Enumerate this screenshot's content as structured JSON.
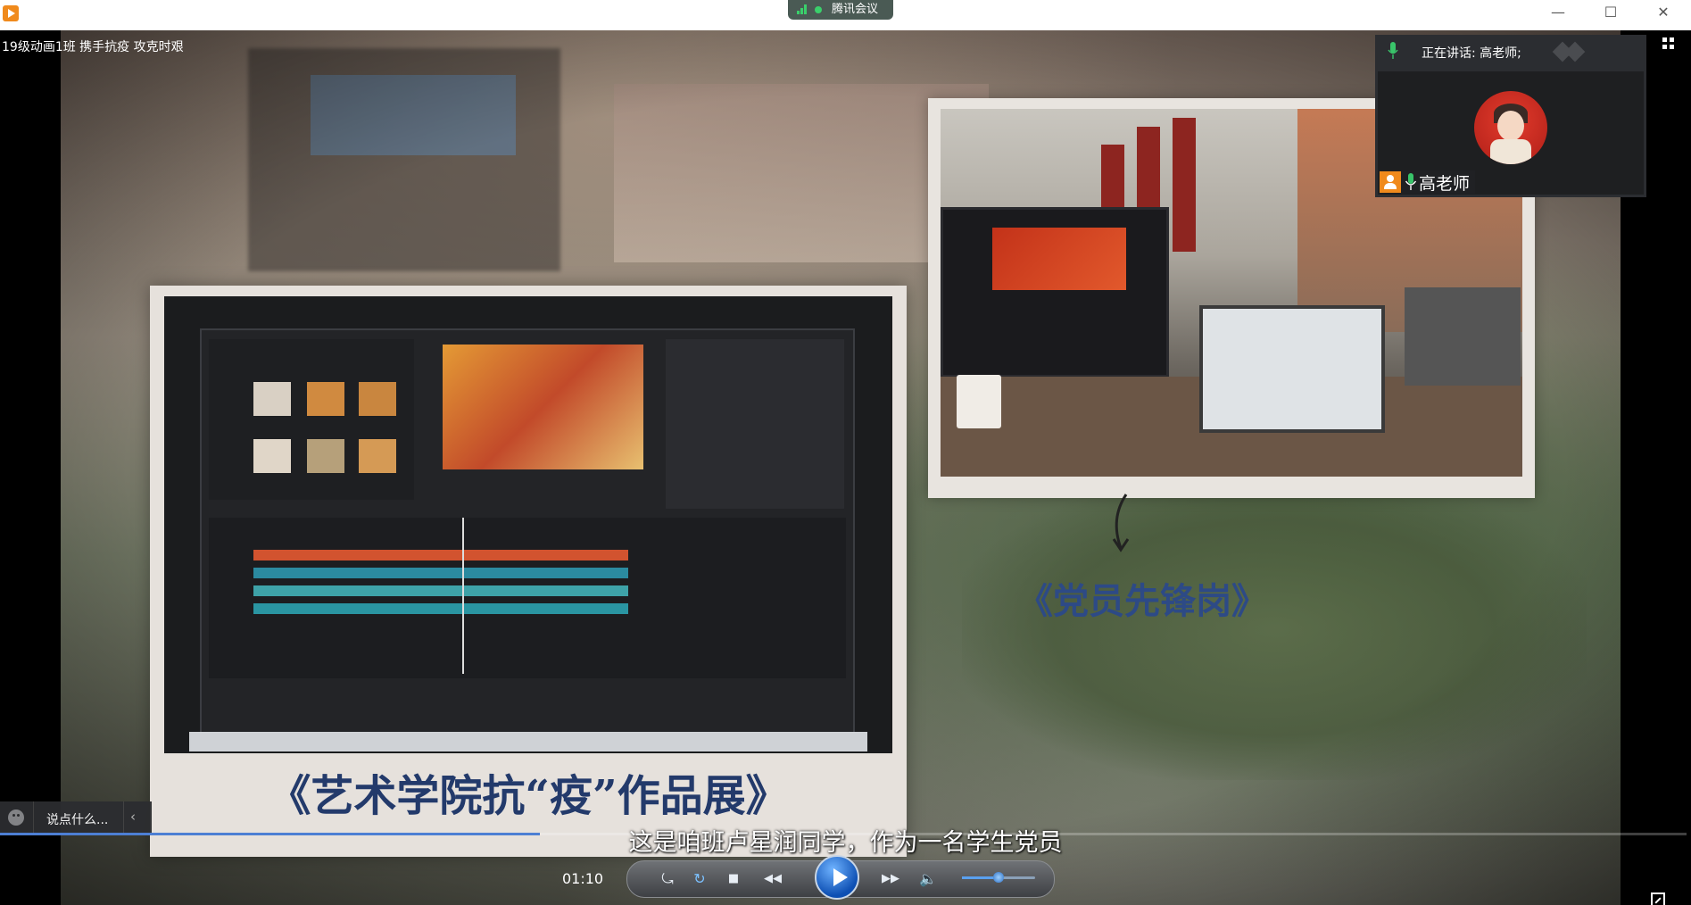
{
  "window": {
    "meeting_badge": "腾讯会议",
    "minimize": "—",
    "maximize": "☐",
    "close": "✕"
  },
  "video": {
    "title": "19级动画1班 携手抗疫   攻克时艰",
    "caption_left": "《艺术学院抗“疫”作品展》",
    "caption_right": "《党员先锋岗》",
    "subtitle": "这是咱班卢星润同学，作为一名学生党员"
  },
  "speaker": {
    "label": "正在讲话: 高老师;",
    "name": "高老师"
  },
  "chat": {
    "placeholder": "说点什么...",
    "toggle": "‹"
  },
  "player": {
    "time": "01:10",
    "progress": 0.32,
    "volume": 0.5,
    "controls": {
      "loop": "⤿",
      "refresh": "↻",
      "stop": "■",
      "rewind": "◀◀",
      "forward": "▶▶",
      "volume": "🔈"
    }
  },
  "colors": {
    "accent": "#4d7fd4",
    "caption": "#233a6b",
    "app_icon": "#f08a1c"
  }
}
